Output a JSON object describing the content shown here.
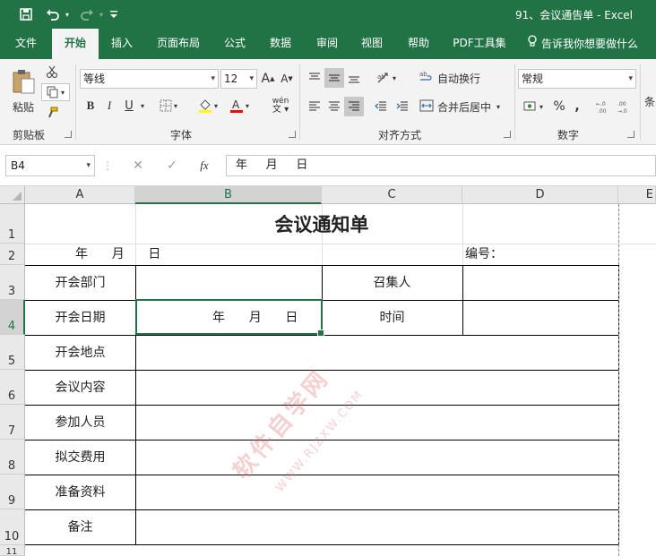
{
  "titlebar": {
    "document_title": "91、会议通告单  -  Excel",
    "icons": [
      "save-icon",
      "undo-icon",
      "redo-icon",
      "customize-quick-access-icon"
    ]
  },
  "ribbon_tabs": [
    "文件",
    "开始",
    "插入",
    "页面布局",
    "公式",
    "数据",
    "审阅",
    "视图",
    "帮助",
    "PDF工具集"
  ],
  "active_tab": "开始",
  "tell_me": "告诉我你想要做什么",
  "clipboard": {
    "paste_label": "粘贴",
    "group_label": "剪贴板"
  },
  "font": {
    "font_name": "等线",
    "font_size": "12",
    "bold": "B",
    "italic": "I",
    "underline": "U",
    "phonetic": "wén",
    "group_label": "字体",
    "fill_color": "#ffff00",
    "font_color": "#ff0000"
  },
  "alignment": {
    "wrap_text": "自动换行",
    "merge_center": "合并后居中",
    "group_label": "对齐方式"
  },
  "number": {
    "format": "常规",
    "percent": "%",
    "comma": ",",
    "group_label": "数字"
  },
  "styles": {
    "partial_label": "条"
  },
  "formula_bar": {
    "name_box": "B4",
    "fx": "fx",
    "value": "年     月     日"
  },
  "sheet": {
    "columns": [
      "A",
      "B",
      "C",
      "D",
      "E"
    ],
    "rows": [
      "1",
      "2",
      "3",
      "4",
      "5",
      "6",
      "7",
      "8",
      "9",
      "10",
      "11"
    ],
    "selected_cell": "B4",
    "title": "会议通知单",
    "date_line": "年      月      日",
    "number_label": "编号：",
    "labels": {
      "dept": "开会部门",
      "convener": "召集人",
      "date": "开会日期",
      "date_value": "年      月      日",
      "time": "时间",
      "place": "开会地点",
      "content": "会议内容",
      "attendees": "参加人员",
      "fees": "拟交费用",
      "materials": "准备资料",
      "remarks": "备注"
    }
  },
  "watermark": {
    "text": "软件自学网",
    "url": "WWW.RJZXW.COM"
  },
  "colors": {
    "excel_green": "#217346"
  }
}
